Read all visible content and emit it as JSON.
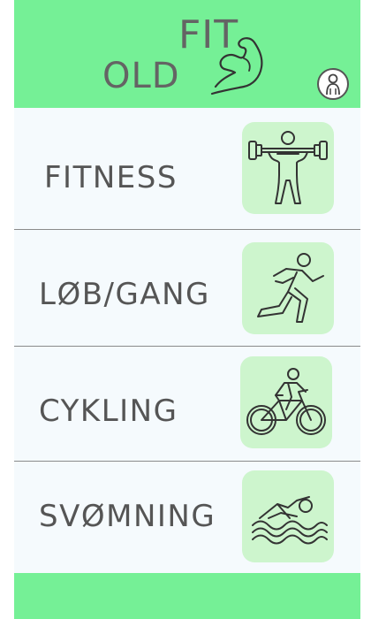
{
  "header": {
    "logo_fit": "FIT",
    "logo_old": "OLD"
  },
  "activities": [
    {
      "label": "FITNESS",
      "icon": "weightlifter-icon"
    },
    {
      "label": "LØB/GANG",
      "icon": "runner-icon"
    },
    {
      "label": "CYKLING",
      "icon": "cyclist-icon"
    },
    {
      "label": "SVØMNING",
      "icon": "swimmer-icon"
    }
  ],
  "colors": {
    "accent_green": "#75f096",
    "tile_green": "#cdf5cd",
    "text_gray": "#555555",
    "background": "#f5fafd"
  }
}
